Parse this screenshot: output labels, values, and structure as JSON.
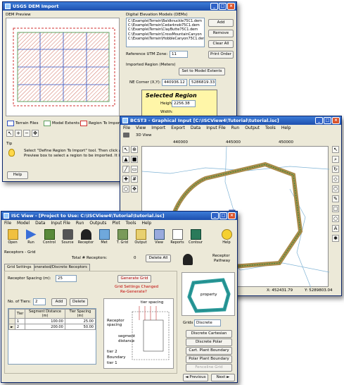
{
  "dem": {
    "title": "USGS DEM Import",
    "preview_label": "DEM Preview",
    "dem_section_label": "Digital Elevation Models (DEMs)",
    "files": [
      "C:\\Example\\Terrain\\Baldknuckle75C1.dem",
      "C:\\Example\\Terrain\\Cedarknob75C1.dem",
      "C:\\Example\\Terrain\\ClayButte75C1.dem",
      "C:\\Example\\Terrain\\CrossMountainCanyon",
      "C:\\Example\\Terrain\\HobbleCanyon75C1.dem"
    ],
    "add_button": "Add",
    "remove_button": "Remove",
    "clear_button": "Clear All",
    "utm_label": "Reference UTM Zone:",
    "utm_value": "11",
    "print_button": "Print Order",
    "region_section_label": "Imported Region (Meters)",
    "set_extents_button": "Set to Model Extents",
    "ne_label": "NE Corner (X,Y):",
    "ne_x": "440936.12",
    "ne_y": "5286819.33",
    "selected_region_title": "Selected Region",
    "height_label": "Height:",
    "height_value": "2256.38",
    "width_label": "Width:",
    "legend_terrain": "Terrain Files",
    "legend_model": "Model Extents",
    "legend_region": "Region To Import",
    "tip_label": "Tip",
    "tip_text_1": "Select \"Define Region To Import\" tool. Then click and",
    "tip_text_2": "Preview box to select a region to be imported. It is",
    "help_button": "Help"
  },
  "bcst": {
    "title": "BCST3 - Graphical Input [C:\\ISCView4\\Tutorial\\tutorial.isc]",
    "menu": [
      "File",
      "View",
      "Import",
      "Export",
      "Data",
      "Input File",
      "Run",
      "Output",
      "Tools",
      "Help"
    ],
    "view_label": "3D View",
    "ruler_ticks": [
      "440000",
      "445000",
      "450000"
    ],
    "status_x": "X: 452431.79",
    "status_y": "Y: 5289803.04"
  },
  "isc": {
    "title": "ISC View - [Project to Use: C:\\ISCView4\\Tutorial\\tutorial.isc]",
    "menu": [
      "File",
      "Model",
      "Data",
      "Input File",
      "Run",
      "Outputs",
      "Plot",
      "Tools",
      "Help"
    ],
    "tools": [
      "Open",
      "Run",
      "Control",
      "Source",
      "Receptor",
      "Met",
      "T. Grid",
      "Output",
      "View",
      "Reports",
      "Contour",
      "Help"
    ],
    "section_label": "Receptors - Grid",
    "total_label": "Total # Receptors:",
    "total_value": "0",
    "delete_all_button": "Delete All",
    "tabs": [
      "Grid Settings",
      "Generated/Discrete Receptors"
    ],
    "spacing_label": "Receptor Spacing (m):",
    "spacing_value": "25",
    "generate_button": "Generate Grid",
    "changes_msg_1": "Grid Settings Changed",
    "changes_msg_2": "Re-Generate?",
    "tiers_label": "No. of Tiers:",
    "tiers_value": "2",
    "add_button": "Add",
    "delete_button": "Delete",
    "col_tier": "Tier",
    "col_distance": "Segment Distance (m)",
    "col_spacing": "Tier Spacing (m)",
    "rows": [
      {
        "tier": "1",
        "distance": "100.00",
        "spacing": "25.00"
      },
      {
        "tier": "2",
        "distance": "200.00",
        "spacing": "50.00"
      }
    ],
    "diagram_title": "tier spacing",
    "diag_receptor": "Receptor spacing",
    "diag_segment_1": "segment",
    "diag_segment_2": "distance",
    "diag_tier2": "tier 2",
    "diag_boundary": "Boundary",
    "diag_tier1": "tier 1",
    "pathway_label_1": "Receptor",
    "pathway_label_2": "Pathway",
    "property_label": "property",
    "grids_label": "Grids",
    "grids_value": "Discrete",
    "side_buttons": [
      "Discrete Cartesian",
      "Discrete Polar",
      "Cart. Plant Boundary",
      "Polar Plant Boundary",
      "Fenceline Grid"
    ],
    "prev_button": "◄ Previous",
    "next_button": "Next ►"
  }
}
